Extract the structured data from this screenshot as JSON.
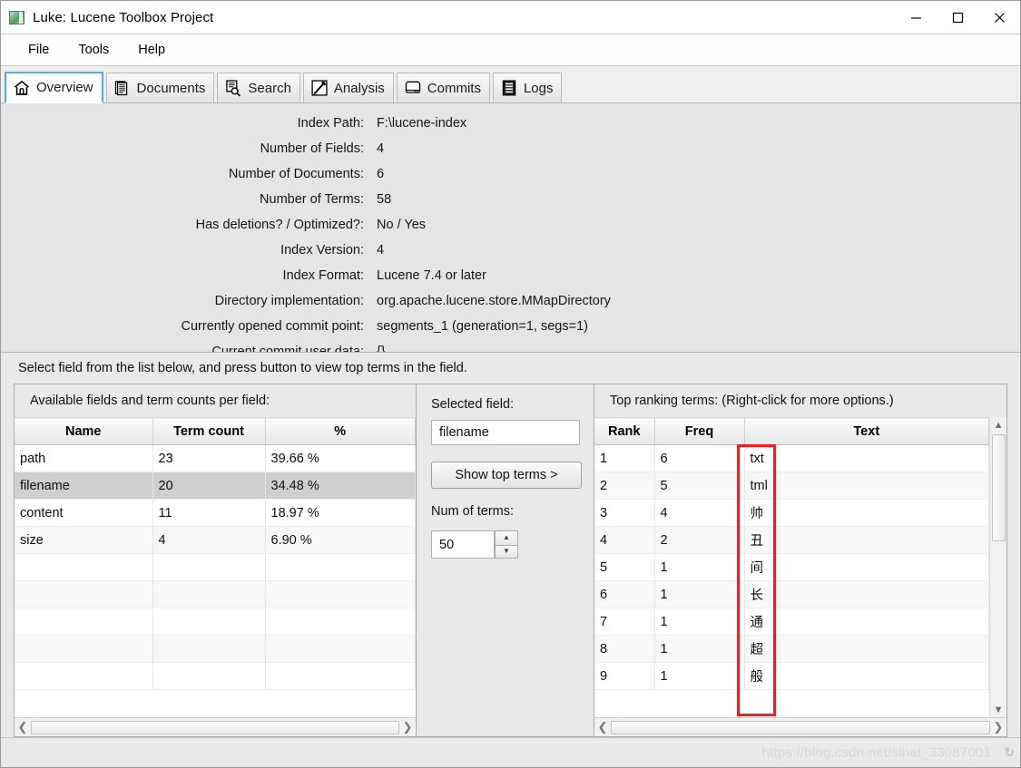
{
  "window": {
    "title": "Luke: Lucene Toolbox Project",
    "icon": "app-window-icon",
    "controls": {
      "minimize": "minimize-icon",
      "maximize": "maximize-icon",
      "close": "close-icon"
    }
  },
  "menu": {
    "items": [
      "File",
      "Tools",
      "Help"
    ]
  },
  "tabs": [
    {
      "label": "Overview",
      "icon": "home-icon",
      "active": true
    },
    {
      "label": "Documents",
      "icon": "documents-icon",
      "active": false
    },
    {
      "label": "Search",
      "icon": "search-doc-icon",
      "active": false
    },
    {
      "label": "Analysis",
      "icon": "pen-icon",
      "active": false
    },
    {
      "label": "Commits",
      "icon": "disk-icon",
      "active": false
    },
    {
      "label": "Logs",
      "icon": "list-icon",
      "active": false
    }
  ],
  "overview": {
    "rows": [
      {
        "label": "Index Path:",
        "value": "F:\\lucene-index"
      },
      {
        "label": "Number of Fields:",
        "value": "4"
      },
      {
        "label": "Number of Documents:",
        "value": "6"
      },
      {
        "label": "Number of Terms:",
        "value": "58"
      },
      {
        "label": "Has deletions? / Optimized?:",
        "value": "No / Yes"
      },
      {
        "label": "Index Version:",
        "value": "4"
      },
      {
        "label": "Index Format:",
        "value": "Lucene 7.4 or later"
      },
      {
        "label": "Directory implementation:",
        "value": "org.apache.lucene.store.MMapDirectory"
      },
      {
        "label": "Currently opened commit point:",
        "value": "segments_1 (generation=1, segs=1)"
      },
      {
        "label": "Current commit user data:",
        "value": "{}"
      }
    ]
  },
  "hint": "Select field from the list below, and press button to view top terms in the field.",
  "fields_panel": {
    "title": "Available fields and term counts per field:",
    "columns": [
      "Name",
      "Term count",
      "%"
    ],
    "rows": [
      {
        "name": "path",
        "term_count": "23",
        "pct": "39.66 %",
        "selected": false
      },
      {
        "name": "filename",
        "term_count": "20",
        "pct": "34.48 %",
        "selected": true
      },
      {
        "name": "content",
        "term_count": "11",
        "pct": "18.97 %",
        "selected": false
      },
      {
        "name": "size",
        "term_count": "4",
        "pct": "6.90 %",
        "selected": false
      }
    ],
    "empty_row_count": 5,
    "scroll_left_icon": "chevron-left-icon",
    "scroll_right_icon": "chevron-right-icon"
  },
  "selected_field_panel": {
    "selected_field_label": "Selected field:",
    "selected_field_value": "filename",
    "show_top_terms_button": "Show top terms >",
    "num_of_terms_label": "Num of terms:",
    "num_of_terms_value": "50",
    "spinner_up_icon": "triangle-up-icon",
    "spinner_down_icon": "triangle-down-icon"
  },
  "terms_panel": {
    "title": "Top ranking terms: (Right-click for more options.)",
    "columns": [
      "Rank",
      "Freq",
      "Text"
    ],
    "rows": [
      {
        "rank": "1",
        "freq": "6",
        "text": "txt"
      },
      {
        "rank": "2",
        "freq": "5",
        "text": "tml"
      },
      {
        "rank": "3",
        "freq": "4",
        "text": "帅"
      },
      {
        "rank": "4",
        "freq": "2",
        "text": "丑"
      },
      {
        "rank": "5",
        "freq": "1",
        "text": "间"
      },
      {
        "rank": "6",
        "freq": "1",
        "text": "长"
      },
      {
        "rank": "7",
        "freq": "1",
        "text": "通"
      },
      {
        "rank": "8",
        "freq": "1",
        "text": "超"
      },
      {
        "rank": "9",
        "freq": "1",
        "text": "般"
      }
    ],
    "scroll_up_icon": "chevron-up-icon",
    "scroll_down_icon": "chevron-down-icon",
    "scroll_left_icon": "chevron-left-icon",
    "scroll_right_icon": "chevron-right-icon",
    "annotation_color": "#ee1d22"
  },
  "statusbar": {
    "watermark": "https://blog.csdn.net/sinat_33087001",
    "watermark_color": "#d7d7d7"
  }
}
